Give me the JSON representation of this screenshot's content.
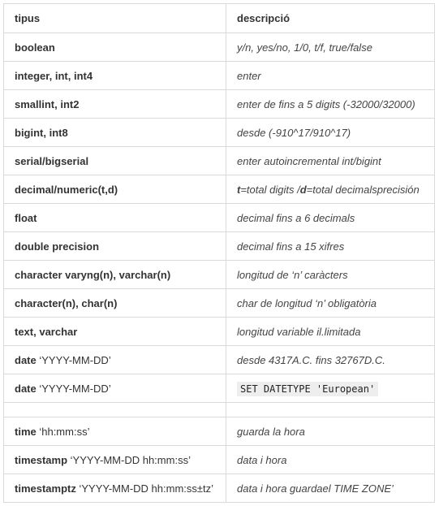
{
  "table": {
    "headers": [
      "tipus",
      "descripció"
    ],
    "rows": [
      {
        "type": "boolean",
        "extra": "",
        "desc": "y/n, yes/no, 1/0, t/f, true/false"
      },
      {
        "type": "integer, int, int4",
        "extra": "",
        "desc": "enter"
      },
      {
        "type": "smallint, int2",
        "extra": "",
        "desc": "enter de fins a 5 digits (-32000/32000)"
      },
      {
        "type": "bigint, int8",
        "extra": "",
        "desc": "desde (-910^17/910^17)"
      },
      {
        "type": "serial/bigserial",
        "extra": "",
        "desc": "enter autoincremental int/bigint"
      },
      {
        "type": "decimal/numeric(t,d)",
        "extra": "",
        "desc_parts": [
          "t",
          "=total digits /",
          "d",
          "=total decimalsprecisión"
        ]
      },
      {
        "type": "float",
        "extra": "",
        "desc": "decimal fins a 6 decimals"
      },
      {
        "type": "double precision",
        "extra": "",
        "desc": "decimal fins a 15 xifres"
      },
      {
        "type": "character varyng(n), varchar(n)",
        "extra": "",
        "desc": "longitud de ‘n’ caràcters"
      },
      {
        "type": "character(n), char(n)",
        "extra": "",
        "desc": "char de longitud ‘n’ obligatòria"
      },
      {
        "type": "text, varchar",
        "extra": "",
        "desc": "longitud variable il.limitada"
      },
      {
        "type": "date",
        "extra": " ‘YYYY-MM-DD’",
        "desc": "desde 4317A.C. fins 32767D.C."
      },
      {
        "type": "date",
        "extra": " ‘YYYY-MM-DD’",
        "code": "SET DATETYPE 'European'"
      },
      {
        "spacer": true
      },
      {
        "type": "time",
        "extra": " ‘hh:mm:ss’",
        "desc": "guarda la hora"
      },
      {
        "type": "timestamp",
        "extra": " ‘YYYY-MM-DD hh:mm:ss’",
        "desc": "data i hora"
      },
      {
        "type": "timestamptz",
        "extra": " ‘YYYY-MM-DD hh:mm:ss±tz’",
        "desc": "data i hora guardael TIME ZONE’"
      }
    ]
  }
}
